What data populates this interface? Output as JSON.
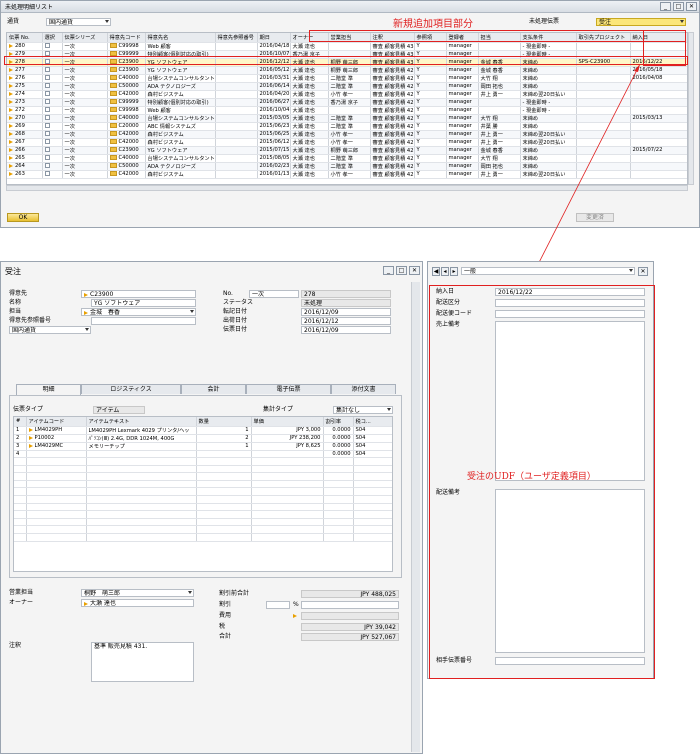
{
  "list_window": {
    "title": "未処理明細リスト",
    "doc_label": "通貨",
    "doc_value": "国内通貨",
    "status_label": "未処理伝票",
    "status_value": "受注",
    "annotation": "新規追加項目部分",
    "ok": "OK",
    "detail_btn": "変更済",
    "columns": [
      "伝票 No.",
      "選択",
      "伝票シリーズ",
      "得意先コード",
      "得意先名",
      "得意先参照番号",
      "期日",
      "オーナー",
      "営業担当",
      "注釈",
      "参照項",
      "登録者",
      "担当",
      "支払条件",
      "取引先プロジェクト",
      "納入日"
    ],
    "rows": [
      [
        "280",
        "",
        "一次",
        "C99998",
        "Web 顧客",
        "",
        "2016/04/18",
        "大瀬 達也",
        "",
        "審査 顧客見積 43",
        "Y",
        "manager",
        "",
        "- 現金即時 -",
        "",
        ""
      ],
      [
        "279",
        "",
        "一次",
        "C99999",
        "特別顧客(個別対応の取引)",
        "",
        "2016/10/07",
        "香乃湯 京子",
        "",
        "審査 顧客見積 43",
        "Y",
        "manager",
        "",
        "- 現金即時 -",
        "",
        ""
      ],
      [
        "278",
        "",
        "一次",
        "C23900",
        "YG ソフトウェア",
        "",
        "2016/12/12",
        "大瀬 達也",
        "桐野 萌三郎",
        "審査 顧客見積 43",
        "Y",
        "manager",
        "金城 春香",
        "末締め",
        "SPS-C23900",
        "2016/12/22"
      ],
      [
        "277",
        "",
        "一次",
        "C23900",
        "YG ソフトウェア",
        "",
        "2016/05/12",
        "大瀬 達也",
        "桐野 萌三郎",
        "審査 顧客見積 42",
        "Y",
        "manager",
        "金城 春香",
        "末締め",
        "",
        "2016/05/18"
      ],
      [
        "276",
        "",
        "一次",
        "C40000",
        "台場システムコンサルタント",
        "",
        "2016/03/31",
        "大瀬 達也",
        "二階堂 準",
        "審査 顧客見積 42",
        "Y",
        "manager",
        "大竹 翔",
        "末締め",
        "",
        "2016/04/08"
      ],
      [
        "275",
        "",
        "一次",
        "C50000",
        "ADA テクノロジーズ",
        "",
        "2016/06/14",
        "大瀬 達也",
        "二階堂 準",
        "審査 顧客見積 42",
        "Y",
        "manager",
        "岡田 拓也",
        "末締め",
        "",
        ""
      ],
      [
        "274",
        "",
        "一次",
        "C42000",
        "森村ビジステム",
        "",
        "2016/04/20",
        "大瀬 達也",
        "小竹 孝一",
        "審査 顧客見積 42",
        "Y",
        "manager",
        "井上 勇一",
        "末締め翌20日払い",
        "",
        ""
      ],
      [
        "273",
        "",
        "一次",
        "C99999",
        "特別顧客(個別対応の取引)",
        "",
        "2016/06/27",
        "大瀬 達也",
        "香乃湯 京子",
        "審査 顧客見積 42",
        "Y",
        "manager",
        "",
        "- 現金即時 -",
        "",
        ""
      ],
      [
        "272",
        "",
        "一次",
        "C99998",
        "Web 顧客",
        "",
        "2016/10/04",
        "大瀬 達也",
        "",
        "審査 顧客見積 42",
        "Y",
        "manager",
        "",
        "- 現金即時 -",
        "",
        ""
      ],
      [
        "270",
        "",
        "一次",
        "C40000",
        "台場システムコンサルタント",
        "",
        "2015/03/05",
        "大瀬 達也",
        "二階堂 準",
        "審査 顧客見積 42",
        "Y",
        "manager",
        "大竹 翔",
        "末締め",
        "",
        "2015/03/13"
      ],
      [
        "269",
        "",
        "一次",
        "C20000",
        "ABC 情報システムズ",
        "",
        "2015/06/23",
        "大瀬 達也",
        "二階堂 準",
        "審査 顧客見積 42",
        "Y",
        "manager",
        "井葉 勝",
        "末締め",
        "",
        ""
      ],
      [
        "268",
        "",
        "一次",
        "C42000",
        "森村ビジステム",
        "",
        "2015/06/25",
        "大瀬 達也",
        "小竹 孝一",
        "審査 顧客見積 42",
        "Y",
        "manager",
        "井上 勇一",
        "末締め翌20日払い",
        "",
        ""
      ],
      [
        "267",
        "",
        "一次",
        "C42000",
        "森村ビジステム",
        "",
        "2015/06/12",
        "大瀬 達也",
        "小竹 孝一",
        "審査 顧客見積 42",
        "Y",
        "manager",
        "井上 勇一",
        "末締め翌20日払い",
        "",
        ""
      ],
      [
        "266",
        "",
        "一次",
        "C23900",
        "YG ソフトウェア",
        "",
        "2015/07/15",
        "大瀬 達也",
        "桐野 萌三郎",
        "審査 顧客見積 42",
        "Y",
        "manager",
        "金城 春香",
        "末締め",
        "",
        "2015/07/22"
      ],
      [
        "265",
        "",
        "一次",
        "C40000",
        "台場システムコンサルタント",
        "",
        "2015/08/05",
        "大瀬 達也",
        "二階堂 準",
        "審査 顧客見積 42",
        "Y",
        "manager",
        "大竹 翔",
        "末締め",
        "",
        ""
      ],
      [
        "264",
        "",
        "一次",
        "C50000",
        "ADA テクノロジーズ",
        "",
        "2016/02/23",
        "大瀬 達也",
        "二階堂 準",
        "審査 顧客見積 42",
        "Y",
        "manager",
        "岡田 拓也",
        "末締め",
        "",
        ""
      ],
      [
        "263",
        "",
        "一次",
        "C42000",
        "森村ビジステム",
        "",
        "2016/01/13",
        "大瀬 達也",
        "小竹 孝一",
        "審査 顧客見積 42",
        "Y",
        "manager",
        "井上 勇一",
        "末締め翌20日払い",
        "",
        ""
      ]
    ]
  },
  "order": {
    "title": "受注",
    "customer_label": "得意先",
    "customer": "C23900",
    "name_label": "名称",
    "name": "YG ソフトウェア",
    "contact_label": "担当",
    "contact": "金城　春香",
    "ref_label": "得意先参照番号",
    "currency": "国内通貨",
    "no_label": "No.",
    "series": "一次",
    "no": "278",
    "status_label": "ステータス",
    "status": "未処理",
    "post_label": "転記日付",
    "post": "2016/12/09",
    "ship_label": "出荷日付",
    "ship": "2016/12/12",
    "doc_date_label": "伝票日付",
    "doc_date": "2016/12/09",
    "tabs": [
      "明細",
      "ロジスティクス",
      "会計",
      "電子伝票",
      "添付文書"
    ],
    "item_type_label": "伝票タイプ",
    "item_type": "アイテム",
    "summary_label": "集計タイプ",
    "summary": "集計なし",
    "grid_cols": [
      "#",
      "アイテムコード",
      "アイテムテキスト",
      "数量",
      "単価",
      "割引率",
      "税コ..."
    ],
    "lines": [
      [
        "1",
        "LM4029PH",
        "LM4029PH Lexmark 4029 プリンタ/ヘッ",
        "1",
        "JPY 3,000",
        "0.0000",
        "S04"
      ],
      [
        "2",
        "P10002",
        "ﾊﾟｿｺﾝ(Ⅲ) 2.4G, DDR 1024M, 400G",
        "2",
        "JPY 238,200",
        "0.0000",
        "S04"
      ],
      [
        "3",
        "LM4029MC",
        "メモリーチップ",
        "1",
        "JPY 8,625",
        "0.0000",
        "S04"
      ],
      [
        "4",
        "",
        "",
        "",
        "",
        "0.0000",
        "S04"
      ]
    ],
    "sales_label": "営業担当",
    "sales": "桐野　萌三郎",
    "owner_label": "オーナー",
    "owner": "大瀬 達也",
    "note_label": "注釈",
    "note": "基準 販売見積 431.",
    "subtotal_label": "割引前合計",
    "subtotal": "JPY 488,025",
    "disc_label": "割引",
    "pct": "%",
    "freight_label": "費用",
    "tax_label": "税",
    "tax": "JPY 39,042",
    "total_label": "合計",
    "total": "JPY 527,067"
  },
  "udf": {
    "combo": "一般",
    "delivery_label": "納入日",
    "delivery": "2016/12/22",
    "f2": "配送区分",
    "f3": "配送便コード",
    "f4": "売上備考",
    "f5": "配送備考",
    "f6": "相手伝票番号",
    "annotation": "受注のUDF（ユーザ定義項目）"
  }
}
